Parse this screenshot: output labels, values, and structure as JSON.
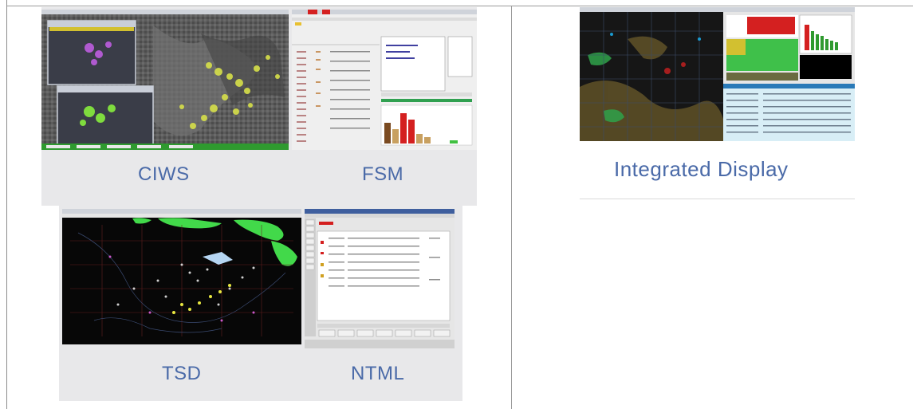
{
  "panels": {
    "ciws": {
      "caption": "CIWS"
    },
    "fsm": {
      "caption": "FSM"
    },
    "tsd": {
      "caption": "TSD"
    },
    "ntml": {
      "caption": "NTML"
    },
    "integrated": {
      "caption": "Integrated Display"
    }
  },
  "colors": {
    "caption_blue": "#4a6aa8",
    "panel_grey": "#e8e8ea",
    "map_green": "#42d94a",
    "storm_yellow": "#d7e04a",
    "bar_red": "#d42020"
  }
}
